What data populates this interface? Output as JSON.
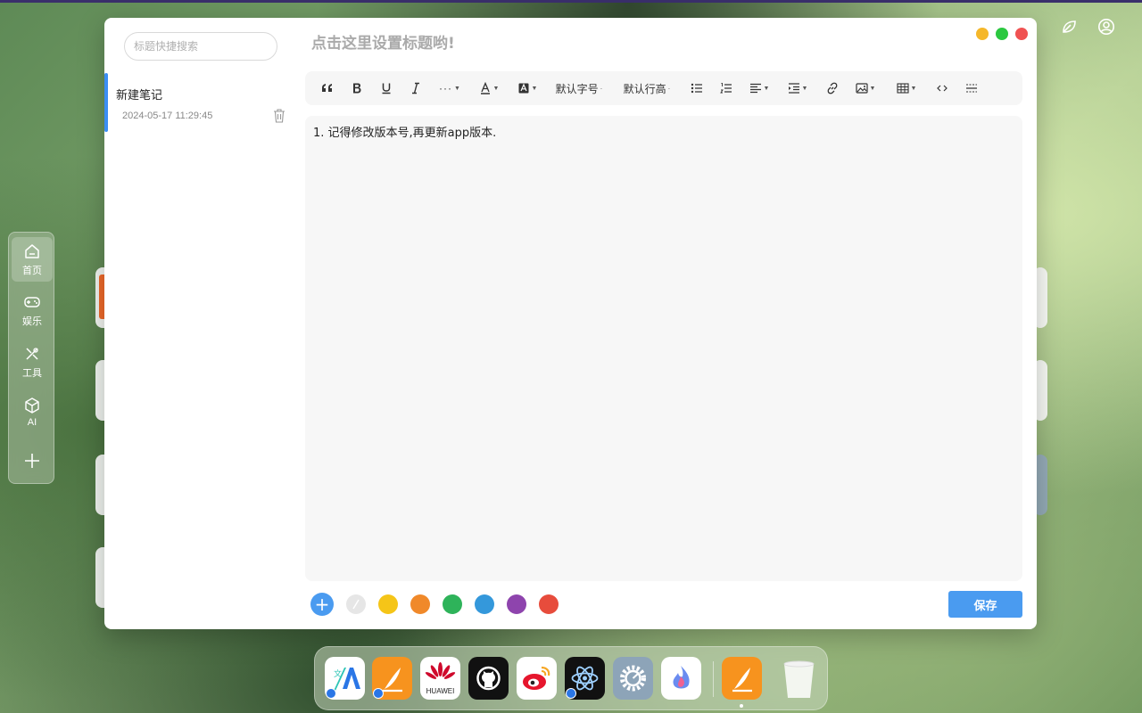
{
  "sidebar": {
    "items": [
      {
        "label": "首页",
        "icon": "home-icon"
      },
      {
        "label": "娱乐",
        "icon": "gamepad-icon"
      },
      {
        "label": "工具",
        "icon": "tools-icon"
      },
      {
        "label": "AI",
        "icon": "cube-icon"
      },
      {
        "label": "",
        "icon": "plus-icon"
      }
    ]
  },
  "notes": {
    "search_placeholder": "标题快捷搜索",
    "items": [
      {
        "title": "新建笔记",
        "time": "2024-05-17 11:29:45"
      }
    ]
  },
  "editor": {
    "title_placeholder": "点击这里设置标题哟!",
    "toolbar": {
      "font_size_label": "默认字号",
      "line_height_label": "默认行高"
    },
    "content_line": "1.  记得修改版本号,再更新app版本."
  },
  "colors": {
    "accent": "#4a9bf0",
    "swatches": [
      "#e6e6e6",
      "#f5c518",
      "#f0892a",
      "#2eb35a",
      "#3498db",
      "#8e44ad",
      "#e74c3c"
    ],
    "traffic": [
      "#f5b72a",
      "#2bc840",
      "#f05252"
    ]
  },
  "footer": {
    "save_label": "保存"
  },
  "dock": {
    "apps": [
      {
        "icon": "translate-icon"
      },
      {
        "icon": "notes-app-icon"
      },
      {
        "icon": "huawei-icon",
        "label": "HUAWEI"
      },
      {
        "icon": "github-icon"
      },
      {
        "icon": "weibo-icon"
      },
      {
        "icon": "atom-icon"
      },
      {
        "icon": "settings-icon"
      },
      {
        "icon": "flame-icon"
      },
      {
        "icon": "notes-app-icon"
      },
      {
        "icon": "trash-icon"
      }
    ]
  }
}
